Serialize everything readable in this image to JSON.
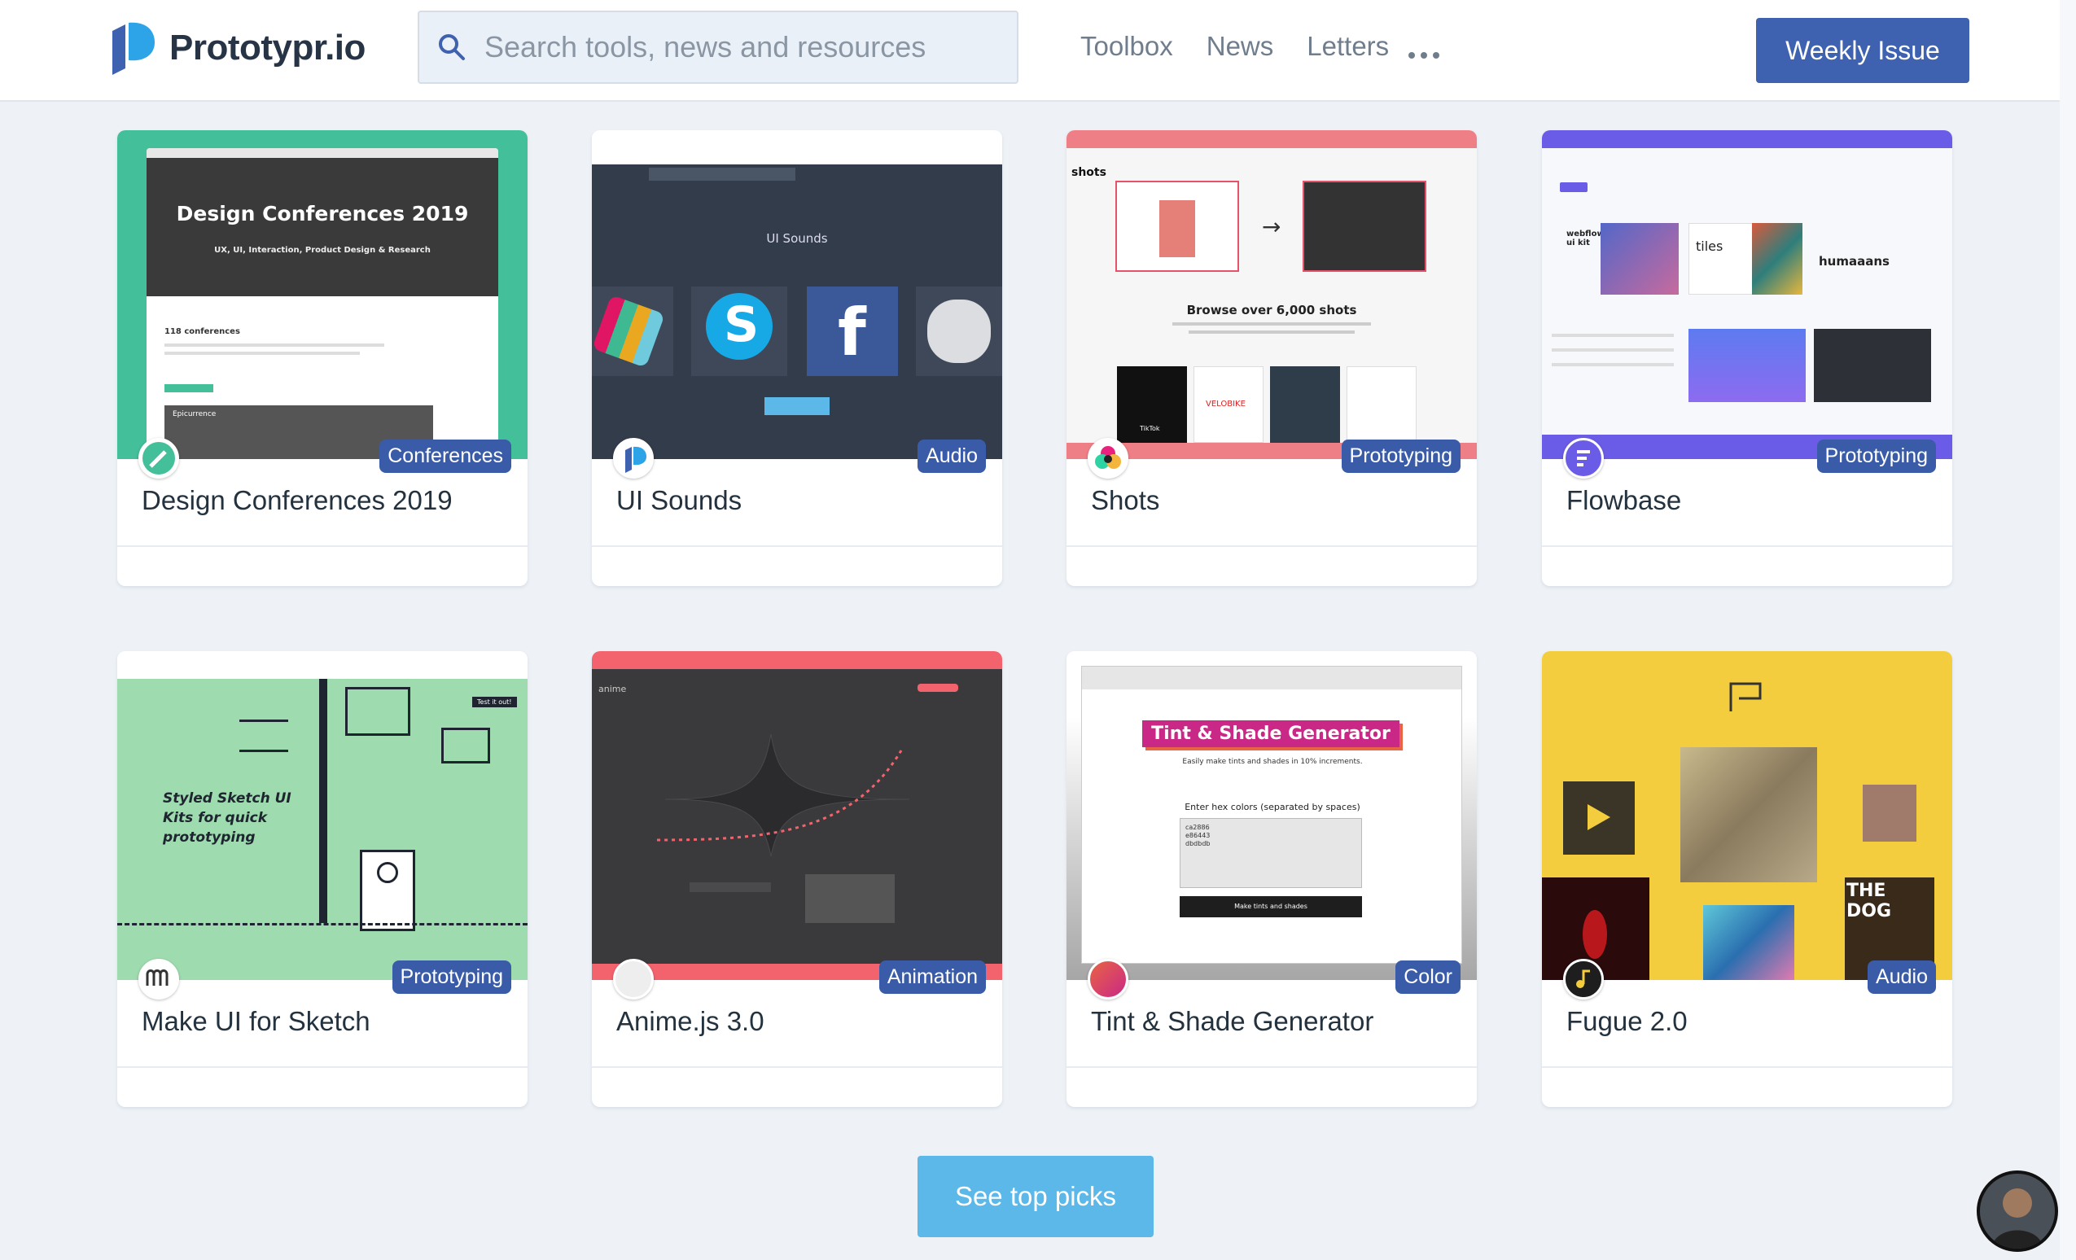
{
  "header": {
    "brand": "Prototypr.io",
    "search_placeholder": "Search tools, news and resources",
    "nav": [
      "Toolbox",
      "News",
      "Letters"
    ],
    "cta": "Weekly Issue"
  },
  "cards": [
    {
      "title": "Design Conferences 2019",
      "badge": "Conferences",
      "preview_heading": "Design Conferences 2019",
      "preview_sub": "UX, UI, Interaction, Product Design & Research",
      "preview_count": "118 conferences",
      "preview_event": "Epicurrence"
    },
    {
      "title": "UI Sounds",
      "badge": "Audio",
      "preview_heading": "UI Sounds"
    },
    {
      "title": "Shots",
      "badge": "Prototyping",
      "preview_logo": "shots",
      "preview_heading": "Browse over 6,000 shots",
      "preview_brand": "VELOBIKE",
      "preview_tag": "TikTok"
    },
    {
      "title": "Flowbase",
      "badge": "Prototyping",
      "preview_tile1": "webflow ui kit",
      "preview_tile2": "tiles",
      "preview_tile3": "humaaans"
    },
    {
      "title": "Make UI for Sketch",
      "badge": "Prototyping",
      "preview_text": "Styled Sketch UI Kits for quick prototyping",
      "preview_button": "Test it out!"
    },
    {
      "title": "Anime.js 3.0",
      "badge": "Animation",
      "preview_logo": "anime"
    },
    {
      "title": "Tint & Shade Generator",
      "badge": "Color",
      "preview_heading": "Tint & Shade Generator",
      "preview_sub": "Easily make tints and shades in 10% increments.",
      "preview_label": "Enter hex colors (separated by spaces)",
      "preview_values": [
        "ca2886",
        "e86443",
        "dbdbdb"
      ],
      "preview_button": "Make tints and shades"
    },
    {
      "title": "Fugue 2.0",
      "badge": "Audio",
      "preview_album": "THE DOG"
    }
  ],
  "footer": {
    "see_top": "See top picks"
  },
  "colors": {
    "brand_blue": "#3e62b0",
    "badge_blue": "#3a5ca8",
    "cta_light": "#5bb8e8"
  }
}
